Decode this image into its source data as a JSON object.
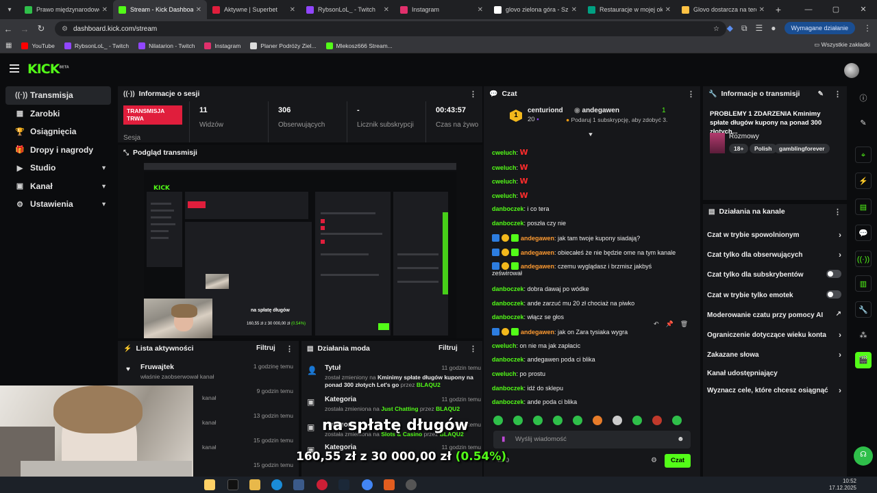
{
  "browser": {
    "tabs": [
      {
        "title": "Prawo międzynarodowe g",
        "color": "#2fbf4a"
      },
      {
        "title": "Stream - Kick Dashboard",
        "color": "#53fc18"
      },
      {
        "title": "Aktywne | Superbet",
        "color": "#e01e3c"
      },
      {
        "title": "RybsonLoL_ - Twitch",
        "color": "#9146ff"
      },
      {
        "title": "Instagram",
        "color": "#e1306c"
      },
      {
        "title": "glovo zielona góra - Szuk",
        "color": "#ffffff"
      },
      {
        "title": "Restauracje w mojej okol",
        "color": "#00a082"
      },
      {
        "title": "Glovo dostarcza na teren",
        "color": "#ffc244"
      }
    ],
    "url": "dashboard.kick.com/stream",
    "required_action": "Wymagane działanie",
    "bookmarks": [
      {
        "label": "YouTube",
        "color": "#ff0000"
      },
      {
        "label": "RybsonLoL_ - Twitch",
        "color": "#9146ff"
      },
      {
        "label": "Nilatarion - Twitch",
        "color": "#9146ff"
      },
      {
        "label": "Instagram",
        "color": "#e1306c"
      },
      {
        "label": "Planer Podróży Ziel...",
        "color": "#dddddd"
      },
      {
        "label": "Mlekosz666 Stream...",
        "color": "#53fc18"
      }
    ],
    "all_bookmarks": "Wszystkie zakładki"
  },
  "kick": {
    "logo": "KICK",
    "logo_beta": "BETA",
    "accent": "#53fc18"
  },
  "sidebar": {
    "items": [
      {
        "label": "Transmisja",
        "icon": "broadcast-icon",
        "glyph": "((·))",
        "chevron": false
      },
      {
        "label": "Zarobki",
        "icon": "earnings-icon",
        "glyph": "▦",
        "chevron": false
      },
      {
        "label": "Osiągnięcia",
        "icon": "trophy-icon",
        "glyph": "🏆",
        "chevron": false
      },
      {
        "label": "Dropy i nagrody",
        "icon": "gift-icon",
        "glyph": "🎁",
        "chevron": false
      },
      {
        "label": "Studio",
        "icon": "studio-icon",
        "glyph": "▶",
        "chevron": true
      },
      {
        "label": "Kanał",
        "icon": "channel-icon",
        "glyph": "▣",
        "chevron": true
      },
      {
        "label": "Ustawienia",
        "icon": "settings-icon",
        "glyph": "⚙",
        "chevron": true
      }
    ]
  },
  "session": {
    "title": "Informacje o sesji",
    "live_badge": "TRANSMISJA TRWA",
    "session_label": "Sesja",
    "stats": [
      {
        "value": "11",
        "label": "Widzów"
      },
      {
        "value": "306",
        "label": "Obserwujących"
      },
      {
        "value": "-",
        "label": "Licznik subskrypcji"
      },
      {
        "value": "00:43:57",
        "label": "Czas na żywo"
      }
    ]
  },
  "preview": {
    "title": "Podgląd transmisji",
    "overlay_text": "na spłatę długów",
    "overlay_amount": "160,55 zł z 30 000,00 zł (0.54%)"
  },
  "activity": {
    "title": "Lista aktywności",
    "filter": "Filtruj",
    "items": [
      {
        "name": "Fruwajtek",
        "desc": "właśnie zaobserwował kanał",
        "time": "1 godzinę temu"
      },
      {
        "name": "",
        "desc": "kanał",
        "time": "9 godzin temu"
      },
      {
        "name": "",
        "desc": "kanał",
        "time": "13 godzin temu"
      },
      {
        "name": "",
        "desc": "kanał",
        "time": "15 godzin temu"
      },
      {
        "name": "",
        "desc": "",
        "time": "15 godzin temu"
      }
    ]
  },
  "mod_actions": {
    "title": "Działania moda",
    "filter": "Filtruj",
    "items": [
      {
        "title": "Tytuł",
        "desc_pre": "został zmieniony na",
        "value": "Kminimy spłate długów kupony na ponad 300 złotych Let's go",
        "by": "przez",
        "user": "BLAQU2",
        "time": "11 godzin temu"
      },
      {
        "title": "Kategoria",
        "desc_pre": "została zmieniona na",
        "value": "Just Chatting",
        "by": "przez",
        "user": "BLAQU2",
        "time": "11 godzin temu"
      },
      {
        "title": "Kategoria",
        "desc_pre": "została zmieniona na",
        "value": "Slots & Casino",
        "by": "przez",
        "user": "BLAQU2",
        "time": "11 godzin temu"
      },
      {
        "title": "Kategoria",
        "desc_pre": "",
        "value": "",
        "by": "",
        "user": "",
        "time": "11 godzin temu"
      }
    ]
  },
  "chat": {
    "title": "Czat",
    "pinned": {
      "rank": "1",
      "user": "centuriond",
      "count": "20",
      "target": "andegawen",
      "right_count": "1",
      "note": "Podaruj 1 subskrypcję, aby zdobyć 3."
    },
    "messages": [
      {
        "user": "cweluch",
        "text": "W",
        "style": "w",
        "badges": false
      },
      {
        "user": "cweluch",
        "text": "W",
        "style": "w",
        "badges": false
      },
      {
        "user": "cweluch",
        "text": "W",
        "style": "w",
        "badges": false
      },
      {
        "user": "cweluch",
        "text": "W",
        "style": "w",
        "badges": false
      },
      {
        "user": "danboczek",
        "text": "i co tera",
        "style": "",
        "badges": false
      },
      {
        "user": "danboczek",
        "text": "poszła czy nie",
        "style": "",
        "badges": false
      },
      {
        "user": "andegawen",
        "text": "jak tam twoje kupony siadają?",
        "style": "",
        "badges": true
      },
      {
        "user": "andegawen",
        "text": "obiecałeś że nie będzie ome na tym kanale",
        "style": "",
        "badges": true
      },
      {
        "user": "andegawen",
        "text": "czemu wyglądasz i brzmisz jakbyś",
        "text2": "ześwirował",
        "style": "",
        "badges": true
      },
      {
        "user": "danboczek",
        "text": "dobra dawaj po wódke",
        "style": "",
        "badges": false
      },
      {
        "user": "danboczek",
        "text": "ande zarzuć mu 20 zł chociaż na piwko",
        "style": "",
        "badges": false
      },
      {
        "user": "danboczek",
        "text": "włącz se głos",
        "style": "",
        "badges": false
      },
      {
        "user": "andegawen",
        "text": "jak on Zara tysiaka wygra",
        "style": "",
        "badges": true
      },
      {
        "user": "cweluch",
        "text": "on nie ma jak zapłacic",
        "style": "",
        "badges": false
      },
      {
        "user": "danboczek",
        "text": "andegawen poda ci blika",
        "style": "",
        "badges": false
      },
      {
        "user": "cweluch",
        "text": "po prostu",
        "style": "",
        "badges": false
      },
      {
        "user": "danboczek",
        "text": "idź do sklepu",
        "style": "",
        "badges": false
      },
      {
        "user": "danboczek",
        "text": "ande poda ci blika",
        "style": "",
        "badges": false
      }
    ],
    "input_placeholder": "Wyślij wiadomość",
    "points": "0",
    "send_label": "Czat"
  },
  "stream_info": {
    "title": "Informacje o transmisji",
    "stream_title": "PROBLEMY 1 ZDARZENIA Kminimy spłate długów kupony na ponad 300 złotych...",
    "category": "Rozmowy",
    "tags": [
      "18+",
      "Polish",
      "gamblingforever"
    ]
  },
  "channel_actions": {
    "title": "Działania na kanale",
    "items": [
      {
        "label": "Czat w trybie spowolnionym",
        "kind": "arrow"
      },
      {
        "label": "Czat tylko dla obserwujących",
        "kind": "arrow"
      },
      {
        "label": "Czat tylko dla subskrybentów",
        "kind": "toggle"
      },
      {
        "label": "Czat w trybie tylko emotek",
        "kind": "toggle"
      },
      {
        "label": "Moderowanie czatu przy pomocy AI",
        "kind": "external"
      },
      {
        "label": "Ograniczenie dotyczące wieku konta",
        "kind": "arrow"
      },
      {
        "label": "Zakazane słowa",
        "kind": "arrow"
      },
      {
        "label": "Kanał udostępniający",
        "kind": "none"
      },
      {
        "label": "Wyznacz cele, które chcesz osiągnąć",
        "kind": "arrow"
      }
    ]
  },
  "taskbar": {
    "time": "10:52",
    "date": "17.12.2025"
  }
}
